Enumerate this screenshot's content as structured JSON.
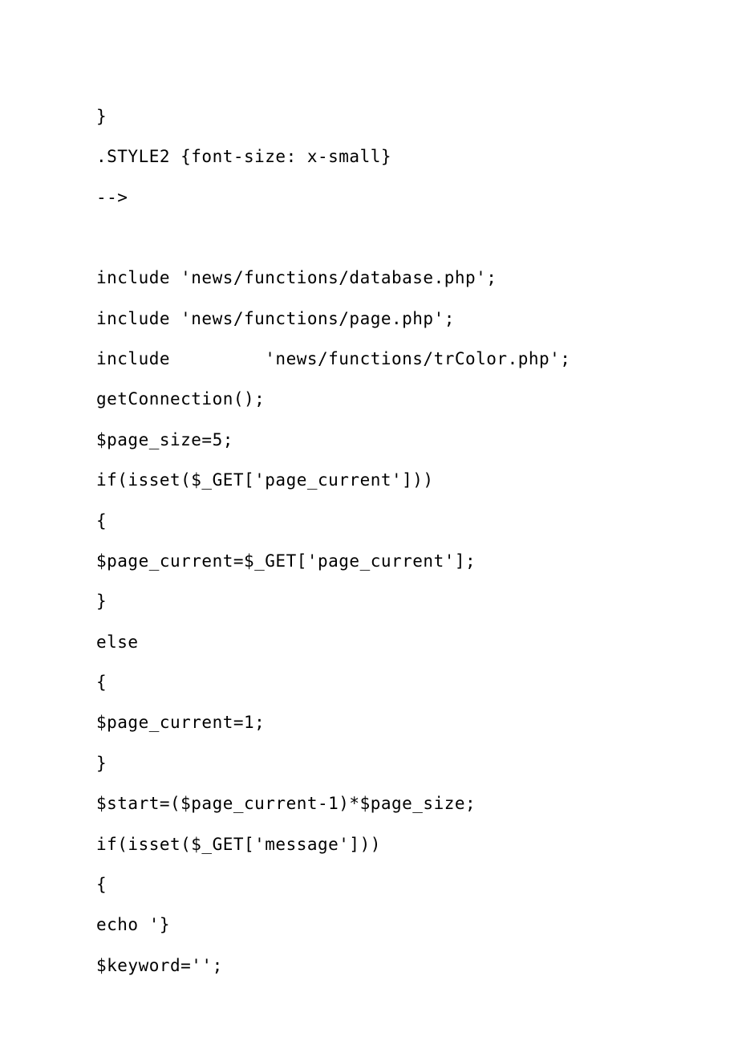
{
  "lines": [
    "}",
    ".STYLE2 {font-size: x-small}",
    "-->",
    "",
    "include 'news/functions/database.php';",
    "include 'news/functions/page.php';",
    "include         'news/functions/trColor.php'; ",
    "getConnection();",
    "$page_size=5;",
    "if(isset($_GET['page_current']))",
    "{",
    "$page_current=$_GET['page_current'];",
    "}",
    "else",
    "{",
    "$page_current=1;",
    "}",
    "$start=($page_current-1)*$page_size;",
    "if(isset($_GET['message']))",
    "{",
    "echo '}",
    "$keyword='';"
  ]
}
